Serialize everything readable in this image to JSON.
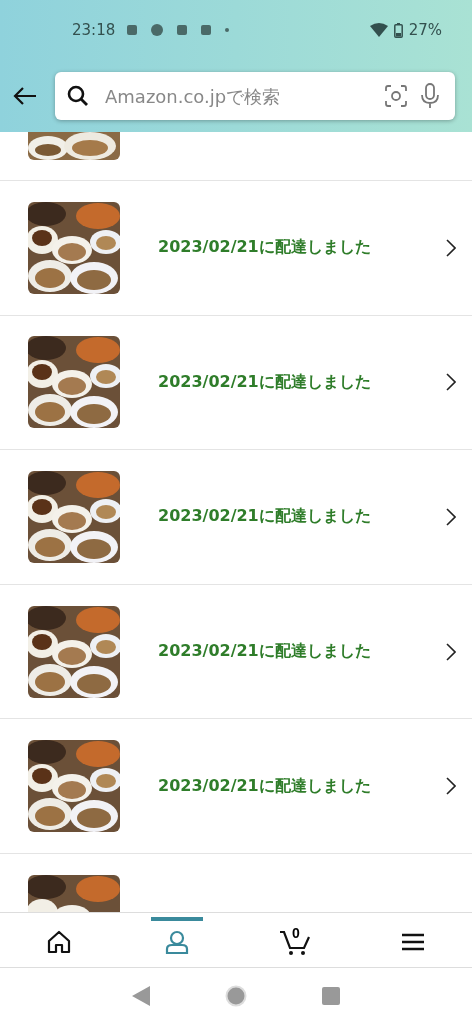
{
  "status_bar": {
    "time": "23:18",
    "battery": "27%"
  },
  "search": {
    "placeholder": "Amazon.co.jpで検索"
  },
  "orders": [
    {
      "status": "2023/02/21に配達しました"
    },
    {
      "status": "2023/02/21に配達しました"
    },
    {
      "status": "2023/02/21に配達しました"
    },
    {
      "status": "2023/02/21に配達しました"
    },
    {
      "status": "2023/02/21に配達しました"
    }
  ],
  "bottom_nav": [
    {
      "kind": "home",
      "selected": false
    },
    {
      "kind": "account",
      "selected": true
    },
    {
      "kind": "cart",
      "selected": false,
      "count": "0"
    },
    {
      "kind": "menu",
      "selected": false
    }
  ]
}
